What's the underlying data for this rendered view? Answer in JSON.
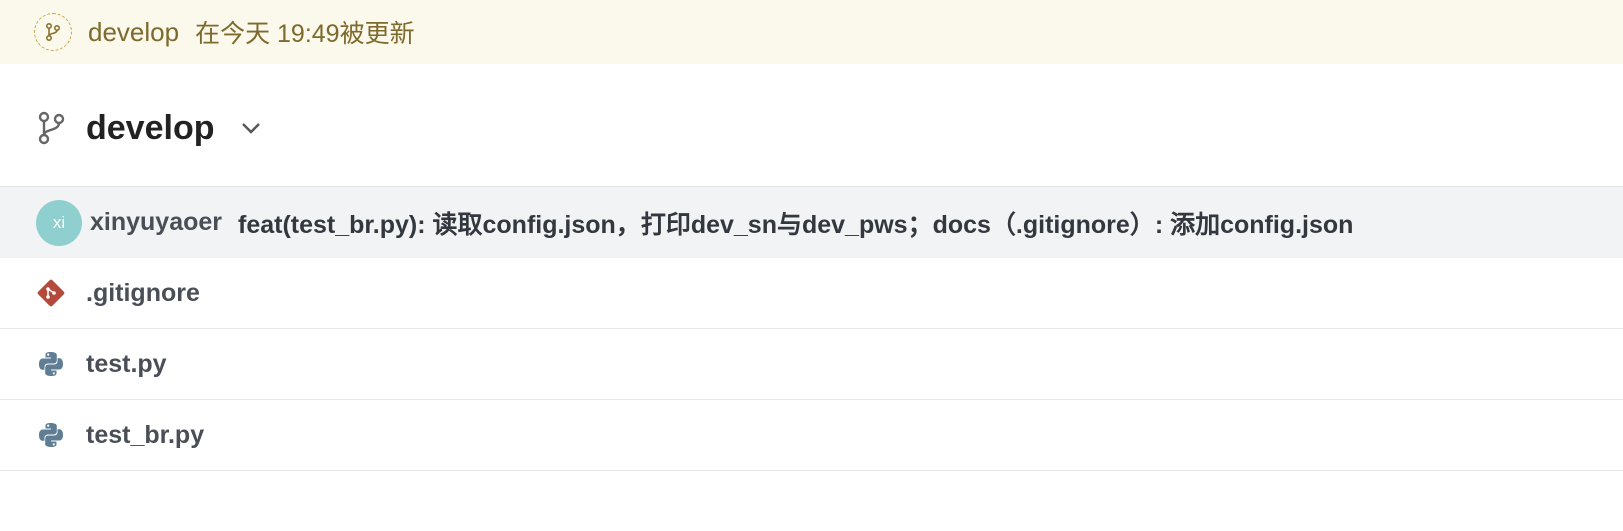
{
  "banner": {
    "branch": "develop",
    "updated_text": "在今天 19:49被更新",
    "icon": "git-branch-icon"
  },
  "header": {
    "branch_name": "develop",
    "icon": "git-branch-icon",
    "chevron": "chevron-down-icon"
  },
  "commit": {
    "avatar_text": "xi",
    "avatar_color": "#8fcfcf",
    "author": "xinyuyaoer",
    "message": "feat(test_br.py): 读取config.json，打印dev_sn与dev_pws；docs（.gitignore）: 添加config.json"
  },
  "files": [
    {
      "name": ".gitignore",
      "icon": "git-file-icon"
    },
    {
      "name": "test.py",
      "icon": "python-file-icon"
    },
    {
      "name": "test_br.py",
      "icon": "python-file-icon"
    }
  ],
  "colors": {
    "banner_bg": "#fbf8ec",
    "banner_text": "#7d6a2c",
    "commit_bg": "#f2f3f5",
    "git_icon": "#b34a3c",
    "python_icon": "#5f7d94"
  }
}
